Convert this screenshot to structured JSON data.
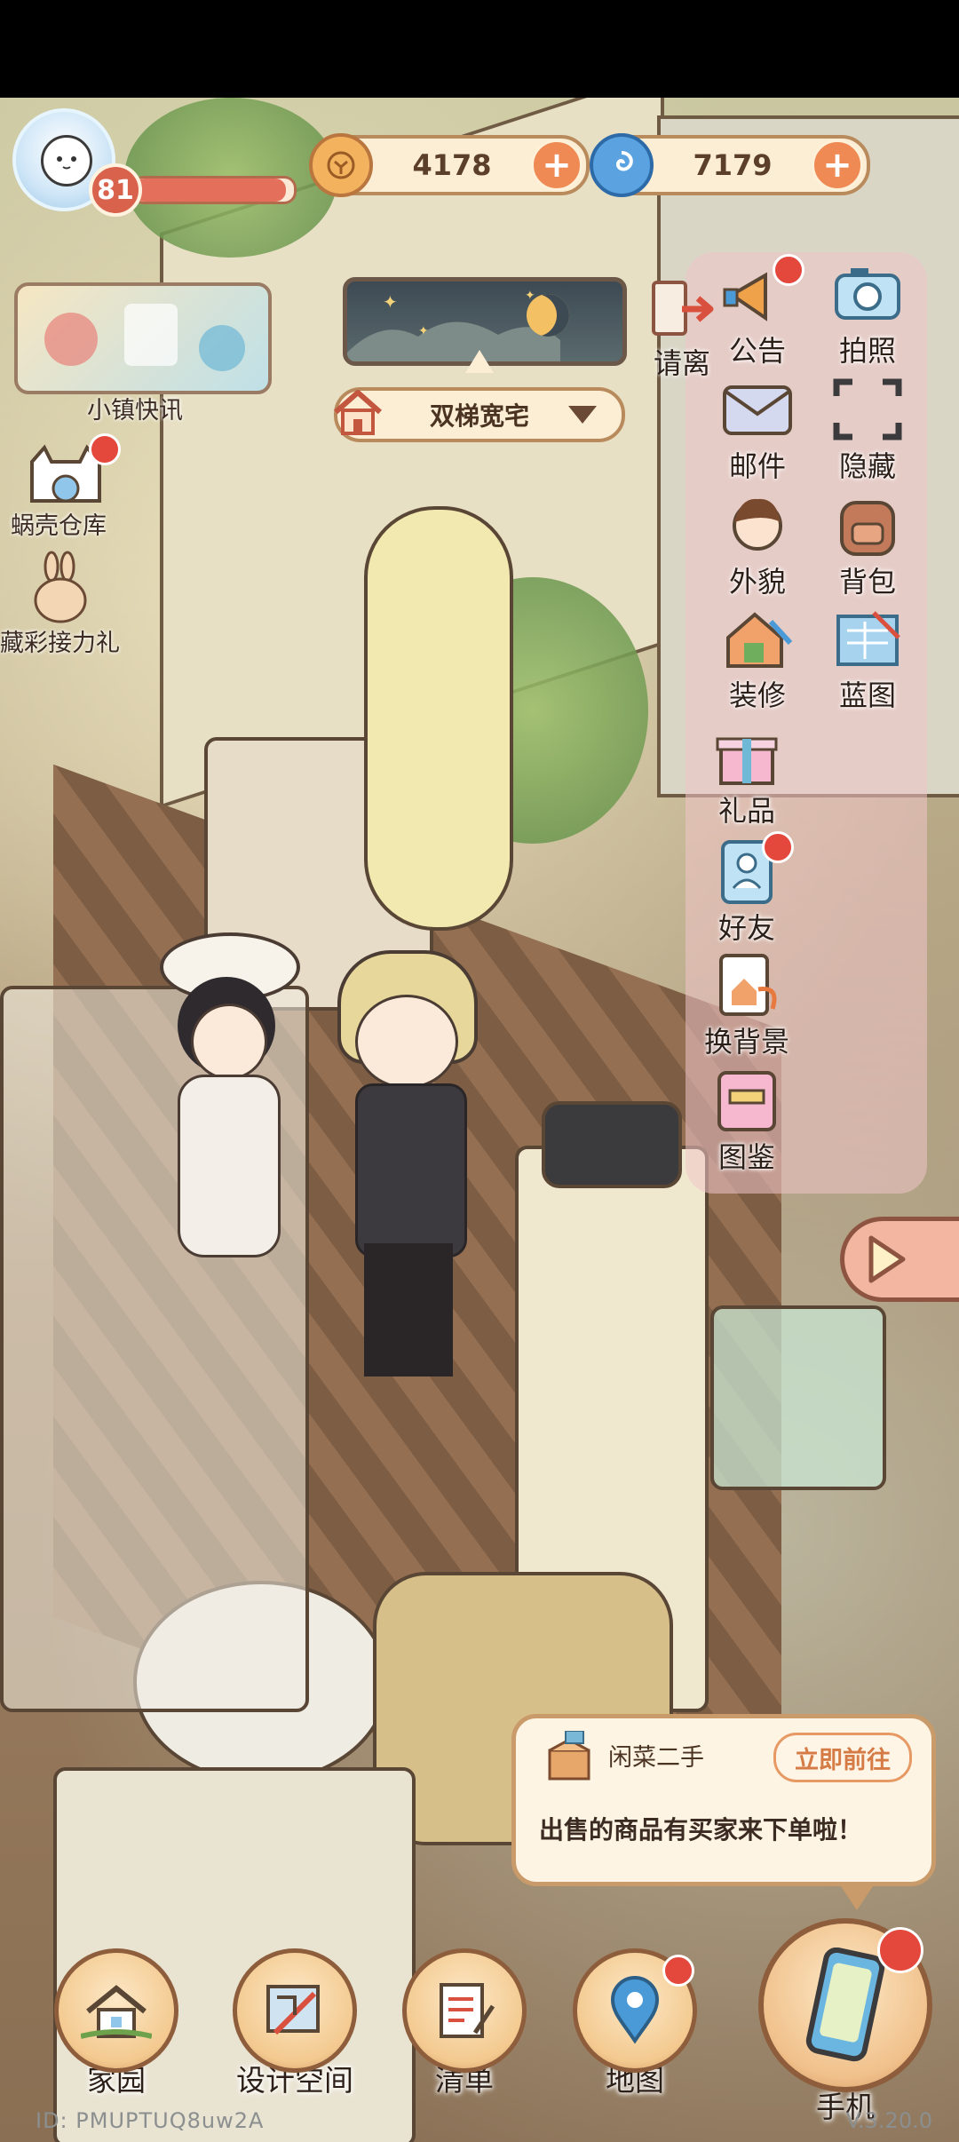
{
  "player": {
    "level": "81",
    "level_progress": 0.95
  },
  "currency": {
    "coins": "4178",
    "shells": "7179"
  },
  "left_menu": {
    "news_label": "小镇快讯",
    "warehouse_label": "蜗壳仓库",
    "relay_gift_label": "藏彩接力礼"
  },
  "house": {
    "name": "双梯宽宅"
  },
  "right_menu": {
    "leave": "请离",
    "items": [
      {
        "label": "公告",
        "icon": "announcement-icon",
        "badge": true
      },
      {
        "label": "拍照",
        "icon": "camera-icon",
        "badge": false
      },
      {
        "label": "邮件",
        "icon": "mail-icon",
        "badge": false
      },
      {
        "label": "隐藏",
        "icon": "hide-frame-icon",
        "badge": false
      },
      {
        "label": "外貌",
        "icon": "appearance-icon",
        "badge": false
      },
      {
        "label": "背包",
        "icon": "backpack-icon",
        "badge": false
      },
      {
        "label": "装修",
        "icon": "renovate-icon",
        "badge": false
      },
      {
        "label": "蓝图",
        "icon": "blueprint-icon",
        "badge": false
      },
      {
        "label": "礼品",
        "icon": "gift-icon",
        "badge": false
      },
      {
        "label": "好友",
        "icon": "friends-icon",
        "badge": true
      },
      {
        "label": "换背景",
        "icon": "background-icon",
        "badge": false
      },
      {
        "label": "图鉴",
        "icon": "catalog-icon",
        "badge": false
      }
    ]
  },
  "notification": {
    "source": "闲菜二手",
    "action": "立即前往",
    "message": "出售的商品有买家来下单啦！"
  },
  "bottom_nav": {
    "home": "家园",
    "design": "设计空间",
    "list": "清单",
    "map": "地图",
    "phone": "手机"
  },
  "footer": {
    "id_text": "ID: PMUPTUQ8uw2A",
    "version": "V.3.20.0"
  },
  "colors": {
    "accent": "#ef8a54",
    "badge": "#e4483c",
    "panel": "#fbeed4"
  }
}
